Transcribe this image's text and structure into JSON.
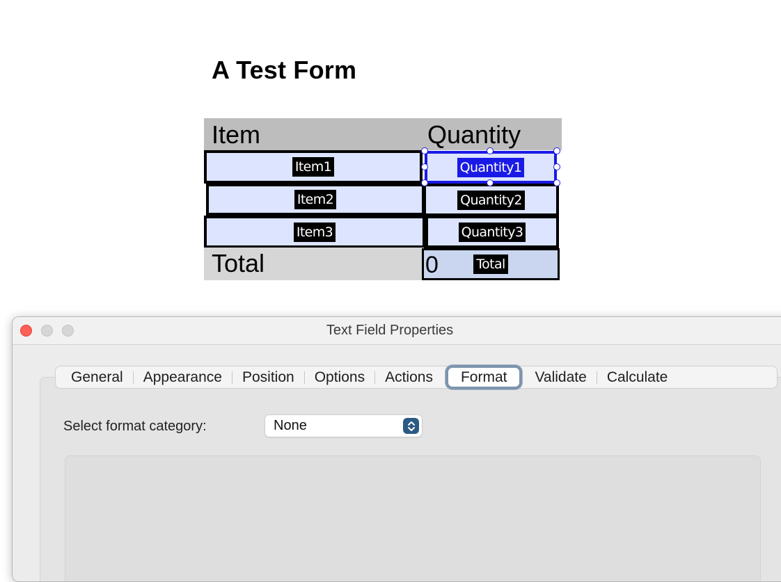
{
  "document": {
    "title": "A Test Form",
    "table": {
      "header_item": "Item",
      "header_quantity": "Quantity",
      "total_label": "Total",
      "total_value": "0",
      "fields": {
        "item1": "Item1",
        "item2": "Item2",
        "item3": "Item3",
        "quantity1": "Quantity1",
        "quantity2": "Quantity2",
        "quantity3": "Quantity3",
        "total": "Total"
      }
    }
  },
  "dialog": {
    "title": "Text Field Properties",
    "tabs": [
      "General",
      "Appearance",
      "Position",
      "Options",
      "Actions",
      "Format",
      "Validate",
      "Calculate"
    ],
    "active_tab": "Format",
    "format": {
      "category_label": "Select format category:",
      "category_value": "None"
    }
  },
  "colors": {
    "field_fill": "#dce4ff",
    "selection_blue": "#1a1ae6",
    "close_button": "#fe5f57",
    "active_tab_ring": "#7d94ad",
    "select_stepper": "#2b5a84"
  }
}
